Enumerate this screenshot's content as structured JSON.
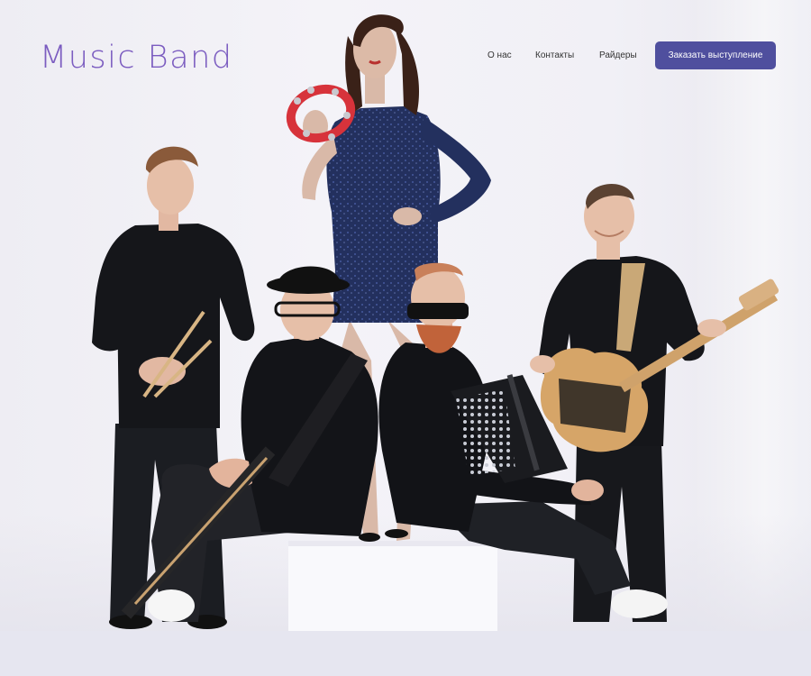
{
  "logo": {
    "text": "Music Band"
  },
  "nav": {
    "about": "О нас",
    "contacts": "Контакты",
    "riders": "Райдеры"
  },
  "cta": {
    "label": "Заказать выступление"
  },
  "colors": {
    "logo": "#7b5cc0",
    "button_bg": "#4f4f9e",
    "button_text": "#ffffff",
    "background": "#f1f0f6"
  },
  "hero": {
    "image": "band-photo"
  }
}
